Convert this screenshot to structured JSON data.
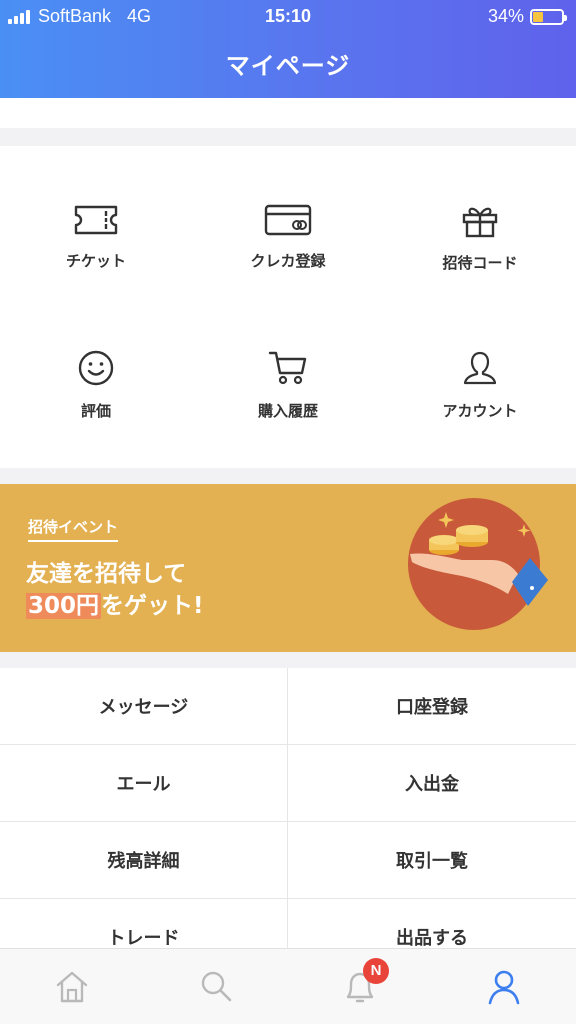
{
  "status_bar": {
    "carrier": "SoftBank",
    "network": "4G",
    "time": "15:10",
    "battery": "34%",
    "battery_level": 0.34,
    "battery_color": "#f5c542"
  },
  "header": {
    "title": "マイページ"
  },
  "shortcuts": [
    {
      "label": "チケット",
      "icon": "ticket-icon"
    },
    {
      "label": "クレカ登録",
      "icon": "credit-card-icon"
    },
    {
      "label": "招待コード",
      "icon": "gift-icon"
    },
    {
      "label": "評価",
      "icon": "smiley-icon"
    },
    {
      "label": "購入履歴",
      "icon": "cart-icon"
    },
    {
      "label": "アカウント",
      "icon": "user-icon"
    }
  ],
  "banner": {
    "tag": "招待イベント",
    "line1": "友達を招待して",
    "amount": "300円",
    "line2_rest": "をゲット!",
    "background": "#e3b052"
  },
  "menu": [
    {
      "label": "メッセージ"
    },
    {
      "label": "口座登録"
    },
    {
      "label": "エール"
    },
    {
      "label": "入出金"
    },
    {
      "label": "残高詳細"
    },
    {
      "label": "取引一覧"
    },
    {
      "label": "トレード"
    },
    {
      "label": "出品する"
    }
  ],
  "tabbar": {
    "items": [
      {
        "icon": "home-icon",
        "active": false
      },
      {
        "icon": "search-icon",
        "active": false
      },
      {
        "icon": "bell-icon",
        "active": false
      },
      {
        "icon": "user-icon",
        "active": true
      }
    ],
    "badge": "N",
    "active_color": "#3d7ff0"
  }
}
